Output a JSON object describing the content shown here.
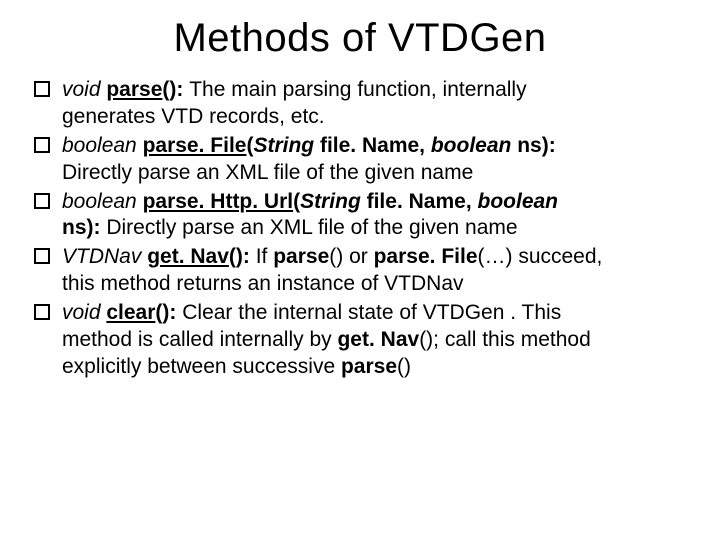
{
  "title": "Methods of VTDGen",
  "items": [
    {
      "sig_ret": "void ",
      "sig_name": "parse",
      "sig_params": "(): ",
      "desc_lead": "The main parsing function, internally ",
      "desc_rest": "generates VTD records, etc."
    },
    {
      "sig_ret": "boolean ",
      "sig_name": "parse. File",
      "param_open": "(",
      "param_t1": "String ",
      "param_n1": "file. Name, ",
      "param_t2": "boolean ",
      "param_n2": "ns): ",
      "desc_rest": "Directly parse an XML file of the given name"
    },
    {
      "sig_ret": "boolean ",
      "sig_name": "parse. Http. Url",
      "param_open": "(",
      "param_t1": "String ",
      "param_n1": "file. Name, ",
      "param_t2": "boolean ",
      "param_n2_line2": "ns): ",
      "desc_rest": "Directly parse an XML file of the given name"
    },
    {
      "sig_ret": "VTDNav ",
      "sig_name": "get. Nav",
      "sig_params": "(): ",
      "desc_lead_a": "If ",
      "desc_bold_a": "parse",
      "desc_mid_a": "() or ",
      "desc_bold_b": "parse. File",
      "desc_mid_b": "(…) succeed, ",
      "desc_rest": "this method returns an instance of VTDNav"
    },
    {
      "sig_ret": "void ",
      "sig_name": "clear",
      "sig_params": "(): ",
      "desc_lead": "Clear the internal state of VTDGen . This ",
      "desc_line2a": "method is called internally by ",
      "desc_bold_a": "get. Nav",
      "desc_line2b": "(); call this method ",
      "desc_line3a": "explicitly between successive ",
      "desc_bold_b": "parse",
      "desc_line3b": "()"
    }
  ]
}
